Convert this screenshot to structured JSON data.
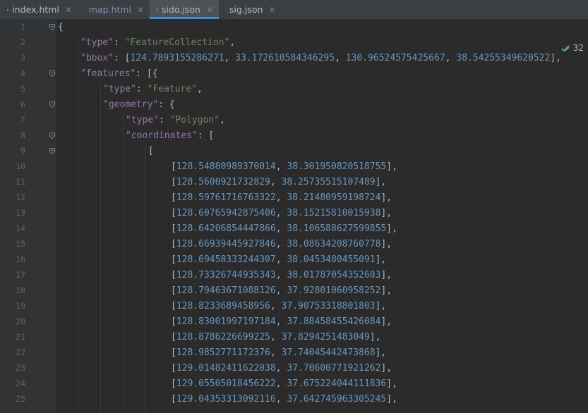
{
  "tabs": [
    {
      "label": "index.html",
      "icon": "html-file-icon",
      "active": false
    },
    {
      "label": "map.html",
      "icon": "html-file-icon",
      "active": false
    },
    {
      "label": "sido.json",
      "icon": "json-file-icon",
      "active": true
    },
    {
      "label": "sig.json",
      "icon": "json-file-icon",
      "active": false
    }
  ],
  "inspection": {
    "count": "32",
    "icon": "checkmark-icon"
  },
  "lines": [
    {
      "n": "1",
      "indent": 0,
      "tokens": [
        [
          "p",
          "{"
        ]
      ]
    },
    {
      "n": "2",
      "indent": 1,
      "tokens": [
        [
          "k",
          "\"type\""
        ],
        [
          "p",
          ": "
        ],
        [
          "s",
          "\"FeatureCollection\""
        ],
        [
          "p",
          ","
        ]
      ]
    },
    {
      "n": "3",
      "indent": 1,
      "tokens": [
        [
          "k",
          "\"bbox\""
        ],
        [
          "p",
          ": ["
        ],
        [
          "n",
          "124.7893155286271"
        ],
        [
          "p",
          ", "
        ],
        [
          "n",
          "33.172610584346295"
        ],
        [
          "p",
          ", "
        ],
        [
          "n",
          "130.96524575425667"
        ],
        [
          "p",
          ", "
        ],
        [
          "n",
          "38.54255349620522"
        ],
        [
          "p",
          "],"
        ]
      ]
    },
    {
      "n": "4",
      "indent": 1,
      "tokens": [
        [
          "k",
          "\"features\""
        ],
        [
          "p",
          ": [{"
        ]
      ]
    },
    {
      "n": "5",
      "indent": 2,
      "tokens": [
        [
          "k",
          "\"type\""
        ],
        [
          "p",
          ": "
        ],
        [
          "s",
          "\"Feature\""
        ],
        [
          "p",
          ","
        ]
      ]
    },
    {
      "n": "6",
      "indent": 2,
      "tokens": [
        [
          "k",
          "\"geometry\""
        ],
        [
          "p",
          ": {"
        ]
      ]
    },
    {
      "n": "7",
      "indent": 3,
      "tokens": [
        [
          "k",
          "\"type\""
        ],
        [
          "p",
          ": "
        ],
        [
          "s",
          "\"Polygon\""
        ],
        [
          "p",
          ","
        ]
      ]
    },
    {
      "n": "8",
      "indent": 3,
      "tokens": [
        [
          "k",
          "\"coordinates\""
        ],
        [
          "p",
          ": ["
        ]
      ]
    },
    {
      "n": "9",
      "indent": 4,
      "tokens": [
        [
          "p",
          "["
        ]
      ]
    },
    {
      "n": "10",
      "indent": 5,
      "tokens": [
        [
          "p",
          "["
        ],
        [
          "n",
          "128.5488098937001 4"
        ],
        [
          "p",
          ", "
        ],
        [
          "n",
          "38.301950820518755"
        ],
        [
          "p",
          "],"
        ]
      ]
    },
    {
      "n": "11",
      "indent": 5,
      "tokens": [
        [
          "p",
          "["
        ],
        [
          "n",
          "128.5600921732829"
        ],
        [
          "p",
          ", "
        ],
        [
          "n",
          "38.25735515107489"
        ],
        [
          "p",
          "],"
        ]
      ]
    },
    {
      "n": "12",
      "indent": 5,
      "tokens": [
        [
          "p",
          "["
        ],
        [
          "n",
          "128.59761716763322"
        ],
        [
          "p",
          ", "
        ],
        [
          "n",
          "38.21480959198724"
        ],
        [
          "p",
          "],"
        ]
      ]
    },
    {
      "n": "13",
      "indent": 5,
      "tokens": [
        [
          "p",
          "["
        ],
        [
          "n",
          "128.60765942875406"
        ],
        [
          "p",
          ", "
        ],
        [
          "n",
          "38.15215810015938"
        ],
        [
          "p",
          "],"
        ]
      ]
    },
    {
      "n": "14",
      "indent": 5,
      "tokens": [
        [
          "p",
          "["
        ],
        [
          "n",
          "128.64206854447866"
        ],
        [
          "p",
          ", "
        ],
        [
          "n",
          "38.106588627599855"
        ],
        [
          "p",
          "],"
        ]
      ]
    },
    {
      "n": "15",
      "indent": 5,
      "tokens": [
        [
          "p",
          "["
        ],
        [
          "n",
          "128.66939445927846"
        ],
        [
          "p",
          ", "
        ],
        [
          "n",
          "38.08634208760778"
        ],
        [
          "p",
          "],"
        ]
      ]
    },
    {
      "n": "16",
      "indent": 5,
      "tokens": [
        [
          "p",
          "["
        ],
        [
          "n",
          "128.69458333244307"
        ],
        [
          "p",
          ", "
        ],
        [
          "n",
          "38.0453480455091"
        ],
        [
          "p",
          "],"
        ]
      ]
    },
    {
      "n": "17",
      "indent": 5,
      "tokens": [
        [
          "p",
          "["
        ],
        [
          "n",
          "128.73326744935343"
        ],
        [
          "p",
          ", "
        ],
        [
          "n",
          "38.01787054352603"
        ],
        [
          "p",
          "],"
        ]
      ]
    },
    {
      "n": "18",
      "indent": 5,
      "tokens": [
        [
          "p",
          "["
        ],
        [
          "n",
          "128.79463671088126"
        ],
        [
          "p",
          ", "
        ],
        [
          "n",
          "37.92801060958252"
        ],
        [
          "p",
          "],"
        ]
      ]
    },
    {
      "n": "19",
      "indent": 5,
      "tokens": [
        [
          "p",
          "["
        ],
        [
          "n",
          "128.8233689458956"
        ],
        [
          "p",
          ", "
        ],
        [
          "n",
          "37.90753318801803"
        ],
        [
          "p",
          "],"
        ]
      ]
    },
    {
      "n": "20",
      "indent": 5,
      "tokens": [
        [
          "p",
          "["
        ],
        [
          "n",
          "128.83001997197184"
        ],
        [
          "p",
          ", "
        ],
        [
          "n",
          "37.88458455426084"
        ],
        [
          "p",
          "],"
        ]
      ]
    },
    {
      "n": "21",
      "indent": 5,
      "tokens": [
        [
          "p",
          "["
        ],
        [
          "n",
          "128.8786226699225"
        ],
        [
          "p",
          ", "
        ],
        [
          "n",
          "37.8294251483049"
        ],
        [
          "p",
          "],"
        ]
      ]
    },
    {
      "n": "22",
      "indent": 5,
      "tokens": [
        [
          "p",
          "["
        ],
        [
          "n",
          "128.9852771172376"
        ],
        [
          "p",
          ", "
        ],
        [
          "n",
          "37.74045442473868"
        ],
        [
          "p",
          "],"
        ]
      ]
    },
    {
      "n": "23",
      "indent": 5,
      "tokens": [
        [
          "p",
          "["
        ],
        [
          "n",
          "129.01482411622038"
        ],
        [
          "p",
          ", "
        ],
        [
          "n",
          "37.70600771921262"
        ],
        [
          "p",
          "],"
        ]
      ]
    },
    {
      "n": "24",
      "indent": 5,
      "tokens": [
        [
          "p",
          "["
        ],
        [
          "n",
          "129.05505018456222"
        ],
        [
          "p",
          ", "
        ],
        [
          "n",
          "37.675224044111836"
        ],
        [
          "p",
          "],"
        ]
      ]
    },
    {
      "n": "25",
      "indent": 5,
      "tokens": [
        [
          "p",
          "["
        ],
        [
          "n",
          "129.04353313092116"
        ],
        [
          "p",
          ", "
        ],
        [
          "n",
          "37.642745963305245"
        ],
        [
          "p",
          "],"
        ]
      ]
    }
  ],
  "colors": {
    "key": "#9876aa",
    "string": "#6a8759",
    "number": "#6897bb",
    "punct": "#a9b7c6",
    "background": "#2b2b2b",
    "gutter": "#313335",
    "accent": "#4a88c7"
  }
}
